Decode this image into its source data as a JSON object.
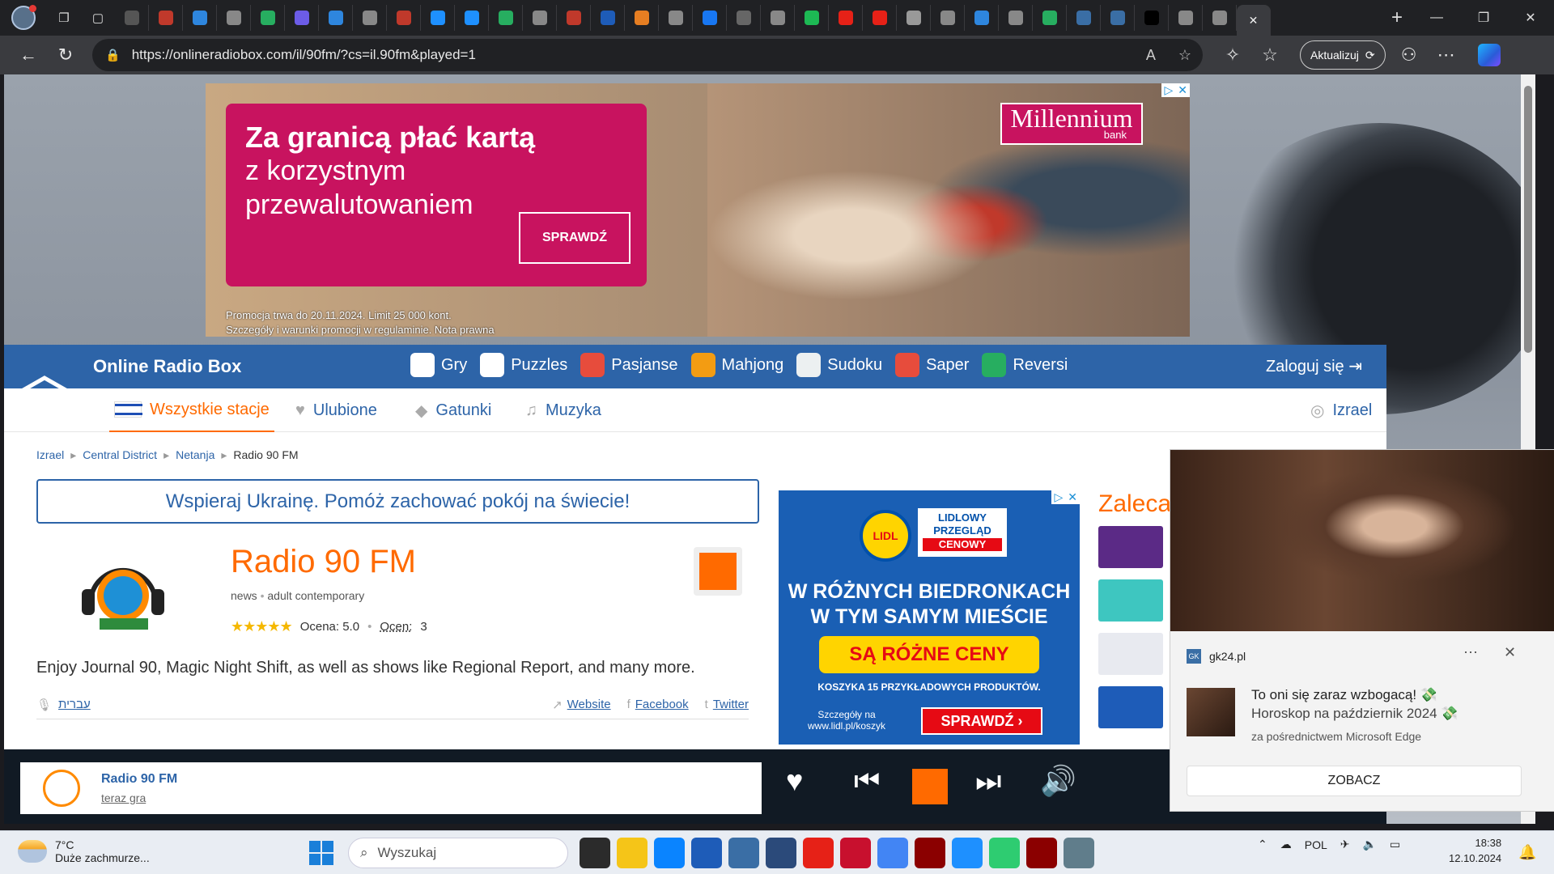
{
  "browser": {
    "url": "https://onlineradiobox.com/il/90fm/?cs=il.90fm&played=1",
    "update_label": "Aktualizuj",
    "tab_colors": [
      "#555",
      "#c0392b",
      "#2e86de",
      "#888",
      "#27ae60",
      "#6c5ce7",
      "#2e86de",
      "#888",
      "#c0392b",
      "#1e90ff",
      "#1e90ff",
      "#27ae60",
      "#888",
      "#c0392b",
      "#1e5cb8",
      "#e67e22",
      "#888",
      "#1877f2",
      "#666",
      "#888",
      "#1db954",
      "#e62117",
      "#e62117",
      "#999",
      "#888",
      "#2e86de",
      "#888",
      "#27ae60",
      "#3a6ea5",
      "#3a6ea5",
      "#000",
      "#888",
      "#888"
    ]
  },
  "ad_top": {
    "headline": "Za granicą płać kartą",
    "subline1": "z korzystnym",
    "subline2": "przewalutowaniem",
    "button": "SPRAWDŹ",
    "fine1": "Promocja trwa do 20.11.2024. Limit 25 000 kont.",
    "fine2": "Szczegóły i warunki promocji w regulaminie. Nota prawna",
    "brand": "Millennium",
    "brand_sub": "bank"
  },
  "site": {
    "name": "Online Radio Box",
    "games": [
      {
        "label": "Gry",
        "color": "#ffffff"
      },
      {
        "label": "Puzzles",
        "color": "#ffffff"
      },
      {
        "label": "Pasjanse",
        "color": "#e74c3c"
      },
      {
        "label": "Mahjong",
        "color": "#f39c12"
      },
      {
        "label": "Sudoku",
        "color": "#ecf0f1"
      },
      {
        "label": "Saper",
        "color": "#e74c3c"
      },
      {
        "label": "Reversi",
        "color": "#27ae60"
      }
    ],
    "login": "Zaloguj się",
    "tabs": [
      "Wszystkie stacje",
      "Ulubione",
      "Gatunki",
      "Muzyka"
    ],
    "country": "Izrael"
  },
  "crumbs": [
    "Izrael",
    "Central District",
    "Netanja",
    "Radio 90 FM"
  ],
  "banner": "Wspieraj Ukrainę. Pomóż zachować pokój na świecie!",
  "station": {
    "title": "Radio 90 FM",
    "tags": [
      "news",
      "adult contemporary"
    ],
    "rating_label": "Ocena: 5.0",
    "votes_label": "Ocen:",
    "votes": "3",
    "stars": "★★★★★",
    "description": "Enjoy Journal 90, Magic Night Shift, as well as shows like Regional Report, and many more.",
    "language": "עברית",
    "website": "Website",
    "facebook": "Facebook",
    "twitter": "Twitter"
  },
  "ad_lidl": {
    "logo": "LIDL",
    "tag1": "LIDLOWY",
    "tag2": "PRZEGLĄD",
    "tag3": "CENOWY",
    "headline1": "W RÓŻNYCH BIEDRONKACH",
    "headline2": "W TYM SAMYM MIEŚCIE",
    "yellow": "SĄ RÓŻNE CENY",
    "small": "KOSZYKA 15 PRZYKŁADOWYCH PRODUKTÓW.",
    "footer1": "Szczegóły na",
    "footer2": "www.lidl.pl/koszyk",
    "button": "SPRAWDŹ"
  },
  "recommend_label": "Zaleca",
  "player": {
    "name": "Radio 90 FM",
    "status": "teraz gra"
  },
  "toast": {
    "source": "gk24.pl",
    "title1": "To oni się zaraz wzbogacą! 💸",
    "title2": "Horoskop na październik 2024 💸",
    "via": "za pośrednictwem Microsoft Edge",
    "button": "ZOBACZ"
  },
  "taskbar": {
    "temp": "7°C",
    "weather": "Duże zachmurze...",
    "search": "Wyszukaj",
    "lang": "POL",
    "time": "18:38",
    "date": "12.10.2024",
    "app_colors": [
      "#2b2b2b",
      "#f5c518",
      "#0a84ff",
      "#1e5cb8",
      "#3a6ea5",
      "#2b4a7a",
      "#e62117",
      "#c8102e",
      "#4285f4",
      "#8b0000",
      "#1e90ff",
      "#2ecc71",
      "#8b0000",
      "#607d8b"
    ]
  }
}
